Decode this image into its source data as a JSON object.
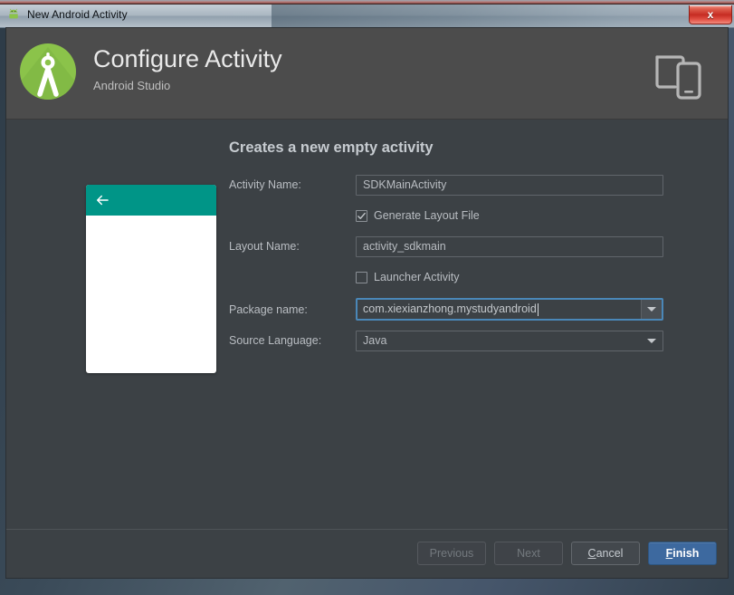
{
  "window": {
    "title": "New Android Activity",
    "title_icon": "android-head-icon",
    "close_label": "x"
  },
  "header": {
    "title": "Configure Activity",
    "subtitle": "Android Studio",
    "logo_icon": "android-studio-logo-icon",
    "devices_icon": "devices-icon",
    "accent_green": "#8bc34a",
    "accent_blue": "#3d699f"
  },
  "main": {
    "step_title": "Creates a new empty activity",
    "preview": {
      "appbar_color": "#009587",
      "back_icon": "arrow-back-icon"
    },
    "fields": {
      "activity_name": {
        "label": "Activity Name:",
        "value": "SDKMainActivity"
      },
      "generate_layout": {
        "label": "Generate Layout File",
        "checked": "true",
        "check_icon": "check-icon"
      },
      "layout_name": {
        "label": "Layout Name:",
        "value": "activity_sdkmain"
      },
      "launcher_activity": {
        "label": "Launcher Activity",
        "checked": "false"
      },
      "package_name": {
        "label": "Package name:",
        "value": "com.xiexianzhong.mystudyandroid",
        "focused": "true",
        "dropdown_icon": "chevron-down-icon"
      },
      "source_language": {
        "label": "Source Language:",
        "value": "Java",
        "dropdown_icon": "chevron-down-icon"
      }
    }
  },
  "footer": {
    "previous": "Previous",
    "next": "Next",
    "cancel_prefix": "C",
    "cancel_rest": "ancel",
    "finish_prefix": "F",
    "finish_rest": "inish"
  }
}
